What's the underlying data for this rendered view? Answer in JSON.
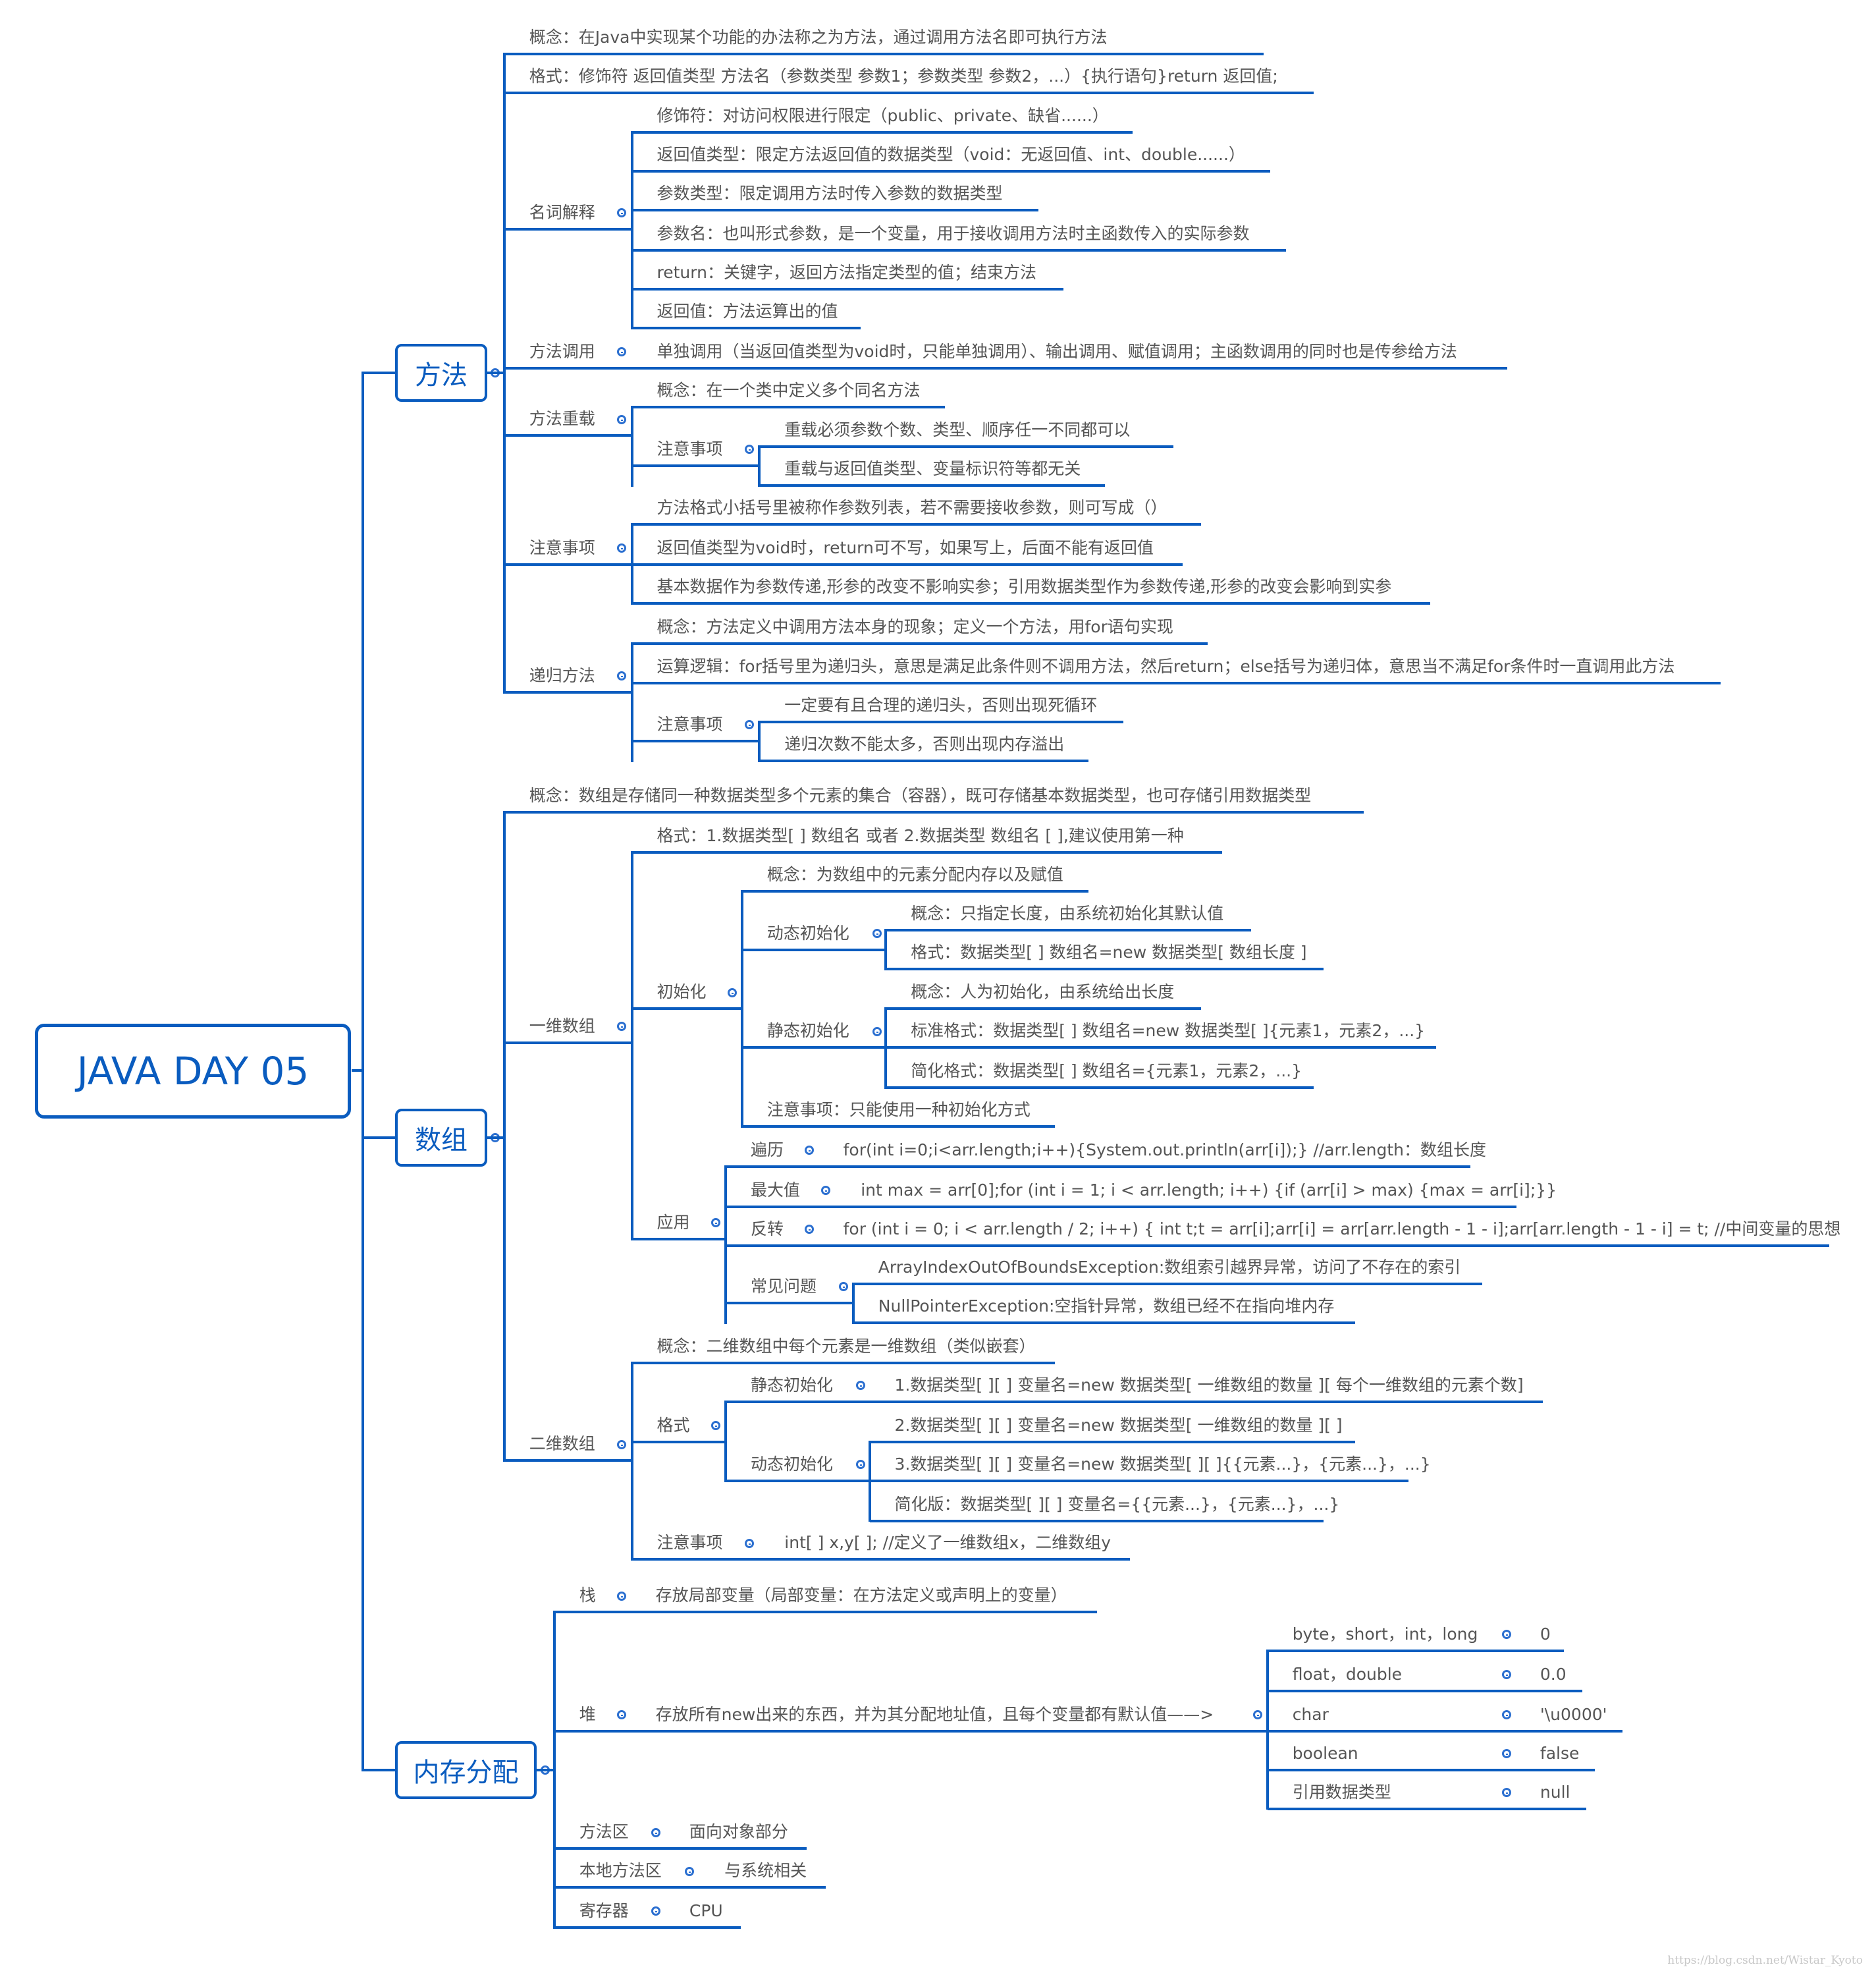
{
  "root": {
    "title": "JAVA DAY 05"
  },
  "method": {
    "title": "方法",
    "concept": "概念：在Java中实现某个功能的办法称之为方法，通过调用方法名即可执行方法",
    "format": "格式：修饰符 返回值类型 方法名（参数类型 参数1；参数类型 参数2，...）{执行语句}return 返回值;",
    "terms": {
      "label": "名词解释",
      "items": [
        "修饰符：对访问权限进行限定（public、private、缺省......）",
        "返回值类型：限定方法返回值的数据类型（void：无返回值、int、double......）",
        "参数类型：限定调用方法时传入参数的数据类型",
        "参数名：也叫形式参数，是一个变量，用于接收调用方法时主函数传入的实际参数",
        "return：关键字，返回方法指定类型的值；结束方法",
        "返回值：方法运算出的值"
      ]
    },
    "call": {
      "label": "方法调用",
      "content": "单独调用（当返回值类型为void时，只能单独调用）、输出调用、赋值调用；主函数调用的同时也是传参给方法"
    },
    "overload": {
      "label": "方法重载",
      "concept": "概念：在一个类中定义多个同名方法",
      "notes": {
        "label": "注意事项",
        "items": [
          "重载必须参数个数、类型、顺序任一不同都可以",
          "重载与返回值类型、变量标识符等都无关"
        ]
      }
    },
    "notes": {
      "label": "注意事项",
      "items": [
        "方法格式小括号里被称作参数列表，若不需要接收参数，则可写成（）",
        "返回值类型为void时，return可不写，如果写上，后面不能有返回值",
        "基本数据作为参数传递,形参的改变不影响实参；引用数据类型作为参数传递,形参的改变会影响到实参"
      ]
    },
    "recursion": {
      "label": "递归方法",
      "concept": "概念：方法定义中调用方法本身的现象；定义一个方法，用for语句实现",
      "logic": "运算逻辑：for括号里为递归头，意思是满足此条件则不调用方法，然后return；else括号为递归体，意思当不满足for条件时一直调用此方法",
      "notes": {
        "label": "注意事项",
        "items": [
          "一定要有且合理的递归头，否则出现死循环",
          "递归次数不能太多，否则出现内存溢出"
        ]
      }
    }
  },
  "array": {
    "title": "数组",
    "concept": "概念：数组是存储同一种数据类型多个元素的集合（容器），既可存储基本数据类型，也可存储引用数据类型",
    "one_dim": {
      "label": "一维数组",
      "format": "格式：1.数据类型[ ] 数组名  或者  2.数据类型  数组名 [ ],建议使用第一种",
      "init": {
        "label": "初始化",
        "concept": "概念：为数组中的元素分配内存以及赋值",
        "dynamic": {
          "label": "动态初始化",
          "items": [
            "概念：只指定长度，由系统初始化其默认值",
            "格式：数据类型[ ] 数组名=new 数据类型[ 数组长度 ]"
          ]
        },
        "static": {
          "label": "静态初始化",
          "items": [
            "概念：人为初始化，由系统给出长度",
            "标准格式：数据类型[ ] 数组名=new 数据类型[ ]{元素1，元素2，...}",
            "简化格式：数据类型[ ] 数组名={元素1，元素2，...}"
          ]
        },
        "note": "注意事项：只能使用一种初始化方式"
      },
      "apply": {
        "label": "应用",
        "traverse": {
          "label": "遍历",
          "content": "for(int i=0;i<arr.length;i++){System.out.println(arr[i]);} //arr.length：数组长度"
        },
        "max": {
          "label": "最大值",
          "content": "int max = arr[0];for (int i = 1; i < arr.length; i++) {if (arr[i] > max) {max = arr[i];}}"
        },
        "reverse": {
          "label": "反转",
          "content": "for (int i = 0; i < arr.length / 2; i++) { int t;t = arr[i];arr[i] = arr[arr.length - 1 - i];arr[arr.length - 1 - i] = t; //中间变量的思想"
        },
        "problems": {
          "label": "常见问题",
          "items": [
            "ArrayIndexOutOfBoundsException:数组索引越界异常，访问了不存在的索引",
            "NullPointerException:空指针异常，数组已经不在指向堆内存"
          ]
        }
      }
    },
    "two_dim": {
      "label": "二维数组",
      "concept": "概念：二维数组中每个元素是一维数组（类似嵌套）",
      "format": {
        "label": "格式",
        "static": {
          "label": "静态初始化",
          "content": "1.数据类型[ ][ ] 变量名=new 数据类型[ 一维数组的数量 ][ 每个一维数组的元素个数]"
        },
        "dynamic": {
          "label": "动态初始化",
          "items": [
            "2.数据类型[ ][ ] 变量名=new 数据类型[ 一维数组的数量 ][ ]",
            "3.数据类型[ ][ ] 变量名=new 数据类型[ ][ ]{{元素...}，{元素...}，...}",
            "简化版：数据类型[ ][ ] 变量名={{元素...}，{元素...}，...}"
          ]
        }
      },
      "notes": {
        "label": "注意事项",
        "content": "int[ ] x,y[ ]; //定义了一维数组x，二维数组y"
      }
    }
  },
  "memory": {
    "title": "内存分配",
    "stack": {
      "label": "栈",
      "content": "存放局部变量（局部变量：在方法定义或声明上的变量）"
    },
    "heap": {
      "label": "堆",
      "content": "存放所有new出来的东西，并为其分配地址值，且每个变量都有默认值——>",
      "defaults": [
        {
          "type": "byte，short，int，long",
          "value": "0"
        },
        {
          "type": "float，double",
          "value": "0.0"
        },
        {
          "type": "char",
          "value": "'\\u0000'"
        },
        {
          "type": "boolean",
          "value": "false"
        },
        {
          "type": "引用数据类型",
          "value": "null"
        }
      ]
    },
    "method_area": {
      "label": "方法区",
      "content": "面向对象部分"
    },
    "native_area": {
      "label": "本地方法区",
      "content": "与系统相关"
    },
    "register": {
      "label": "寄存器",
      "content": "CPU"
    }
  },
  "watermark": "https://blog.csdn.net/Wistar_Kyoto",
  "colors": {
    "line": "#0a5cbf",
    "text": "#555555",
    "title": "#0a5cbf"
  }
}
